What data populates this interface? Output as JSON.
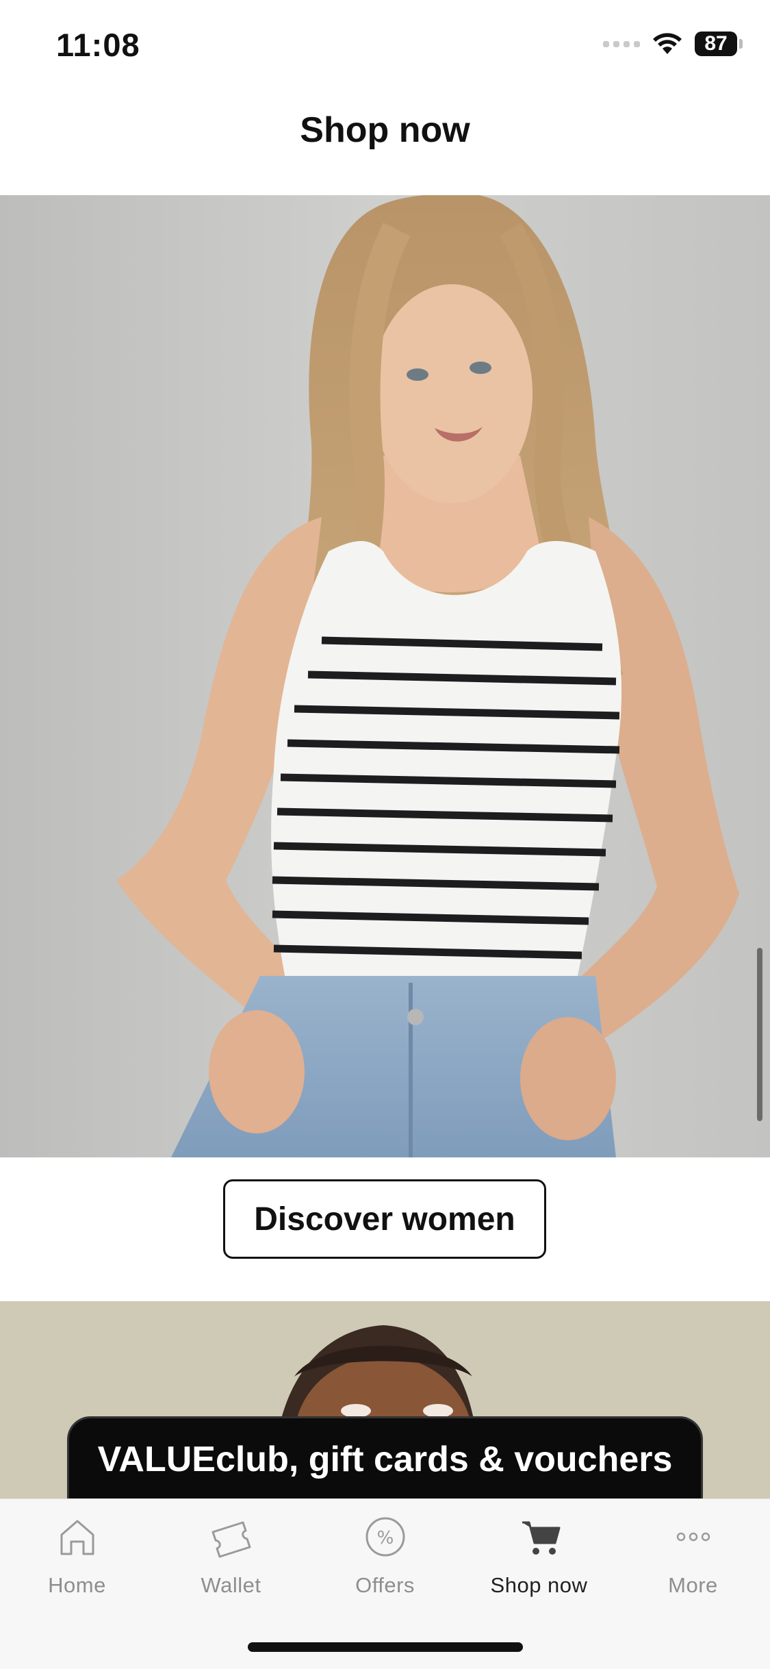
{
  "status_bar": {
    "time": "11:08",
    "battery": "87"
  },
  "header": {
    "title": "Shop now"
  },
  "hero": {
    "cta_label": "Discover women"
  },
  "banner": {
    "label": "VALUEclub, gift cards & vouchers"
  },
  "tab_bar": {
    "items": [
      {
        "label": "Home",
        "icon": "home-icon"
      },
      {
        "label": "Wallet",
        "icon": "ticket-icon"
      },
      {
        "label": "Offers",
        "icon": "percent-icon"
      },
      {
        "label": "Shop now",
        "icon": "cart-icon",
        "active": true
      },
      {
        "label": "More",
        "icon": "more-dots-icon"
      }
    ]
  },
  "colors": {
    "accent": "#111111",
    "inactive_tab": "#8e8e8e",
    "hero_bg": "#c7c7c5"
  }
}
